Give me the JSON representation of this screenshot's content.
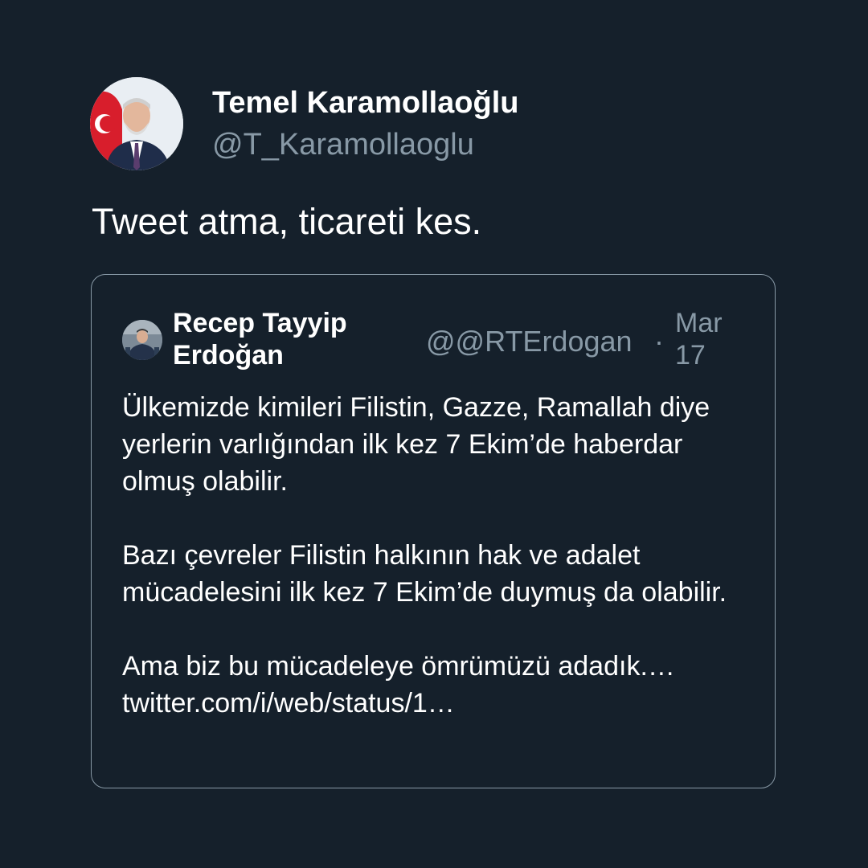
{
  "tweet": {
    "author": {
      "name": "Temel Karamollaoğlu",
      "handle": "@T_Karamollaoglu",
      "avatar": "portrait-with-turkish-flag"
    },
    "text": "Tweet atma, ticareti kes.",
    "quoted": {
      "author": {
        "name": "Recep Tayyip Erdoğan",
        "handle": "@@RTErdogan",
        "avatar": "portrait-small"
      },
      "separator": "·",
      "date": "Mar 17",
      "paragraphs": [
        "Ülkemizde kimileri Filistin, Gazze, Ramallah diye yerlerin varlığından ilk kez 7 Ekim’de haberdar olmuş olabilir.",
        "Bazı çevreler Filistin halkının hak ve adalet mücadelesini ilk kez 7 Ekim’de duymuş da olabilir.",
        "Ama biz bu mücadeleye ömrümüzü adadık.… twitter.com/i/web/status/1…"
      ]
    }
  },
  "colors": {
    "background": "#15202b",
    "primary_text": "#ffffff",
    "secondary_text": "#8899a6",
    "card_border": "#8899a6"
  }
}
